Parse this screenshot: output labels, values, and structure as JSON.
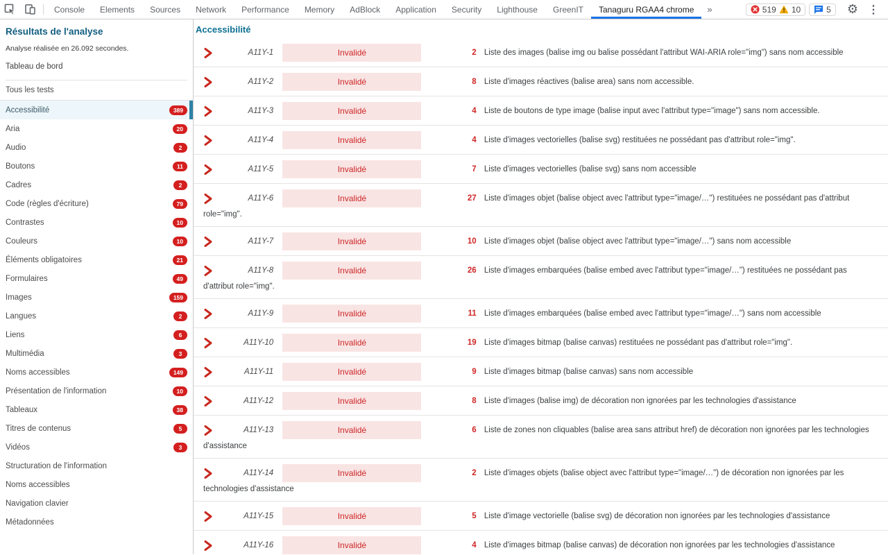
{
  "colors": {
    "accent_teal": "#0e7193",
    "sidebar_title_blue": "#135e80",
    "status_red": "#cd2626",
    "status_bg_pink": "#f9e4e4",
    "badge_red": "#d41f1f",
    "selected_bg": "#edf6fa",
    "selected_bar": "#2e81a5",
    "tab_active_blue": "#1a73e8"
  },
  "devtools": {
    "tabs": [
      {
        "label": "Console"
      },
      {
        "label": "Elements"
      },
      {
        "label": "Sources"
      },
      {
        "label": "Network"
      },
      {
        "label": "Performance"
      },
      {
        "label": "Memory"
      },
      {
        "label": "AdBlock"
      },
      {
        "label": "Application"
      },
      {
        "label": "Security"
      },
      {
        "label": "Lighthouse"
      },
      {
        "label": "GreenIT"
      },
      {
        "label": "Tanaguru RGAA4 chrome",
        "active": true
      }
    ],
    "more_tabs": "»",
    "error_count": "519",
    "warning_count": "10",
    "message_count": "5",
    "gear_glyph": "⚙",
    "dots_glyph": "⋮"
  },
  "sidebar": {
    "title": "Résultats de l'analyse",
    "subtitle": "Analyse réalisée en 26.092 secondes.",
    "dashboard_link": "Tableau de bord",
    "all_tests_label": "Tous les tests",
    "items": [
      {
        "label": "Accessibilité",
        "count": "389",
        "selected": true
      },
      {
        "label": "Aria",
        "count": "20"
      },
      {
        "label": "Audio",
        "count": "2"
      },
      {
        "label": "Boutons",
        "count": "11"
      },
      {
        "label": "Cadres",
        "count": "2"
      },
      {
        "label": "Code (règles d'écriture)",
        "count": "79"
      },
      {
        "label": "Contrastes",
        "count": "10"
      },
      {
        "label": "Couleurs",
        "count": "10"
      },
      {
        "label": "Éléments obligatoires",
        "count": "21"
      },
      {
        "label": "Formulaires",
        "count": "49"
      },
      {
        "label": "Images",
        "count": "159"
      },
      {
        "label": "Langues",
        "count": "2"
      },
      {
        "label": "Liens",
        "count": "6"
      },
      {
        "label": "Multimédia",
        "count": "3"
      },
      {
        "label": "Noms accessibles",
        "count": "149"
      },
      {
        "label": "Présentation de l'information",
        "count": "10"
      },
      {
        "label": "Tableaux",
        "count": "38"
      },
      {
        "label": "Titres de contenus",
        "count": "5"
      },
      {
        "label": "Vidéos",
        "count": "3"
      },
      {
        "label": "Structuration de l'information"
      },
      {
        "label": "Noms accessibles"
      },
      {
        "label": "Navigation clavier"
      },
      {
        "label": "Métadonnées"
      }
    ]
  },
  "main": {
    "title": "Accessibilité",
    "rows": [
      {
        "id": "A11Y-1",
        "status": "Invalidé",
        "count": "2",
        "description": "Liste des images (balise img ou balise possédant l'attribut WAI-ARIA role=\"img\") sans nom accessible"
      },
      {
        "id": "A11Y-2",
        "status": "Invalidé",
        "count": "8",
        "description": "Liste d'images réactives (balise area) sans nom accessible."
      },
      {
        "id": "A11Y-3",
        "status": "Invalidé",
        "count": "4",
        "description": "Liste de boutons de type image (balise input avec l'attribut type=\"image\") sans nom accessible."
      },
      {
        "id": "A11Y-4",
        "status": "Invalidé",
        "count": "4",
        "description": "Liste d'images vectorielles (balise svg) restituées ne possédant pas d'attribut role=\"img\"."
      },
      {
        "id": "A11Y-5",
        "status": "Invalidé",
        "count": "7",
        "description": "Liste d'images vectorielles (balise svg) sans nom accessible"
      },
      {
        "id": "A11Y-6",
        "status": "Invalidé",
        "count": "27",
        "description": "Liste d'images objet (balise object avec l'attribut type=\"image/…\") restituées ne possédant pas d'attribut role=\"img\"."
      },
      {
        "id": "A11Y-7",
        "status": "Invalidé",
        "count": "10",
        "description": "Liste d'images objet (balise object avec l'attribut type=\"image/…\") sans nom accessible"
      },
      {
        "id": "A11Y-8",
        "status": "Invalidé",
        "count": "26",
        "description": "Liste d'images embarquées (balise embed avec l'attribut type=\"image/…\") restituées ne possédant pas d'attribut role=\"img\"."
      },
      {
        "id": "A11Y-9",
        "status": "Invalidé",
        "count": "11",
        "description": "Liste d'images embarquées (balise embed avec l'attribut type=\"image/…\") sans nom accessible"
      },
      {
        "id": "A11Y-10",
        "status": "Invalidé",
        "count": "19",
        "description": "Liste d'images bitmap (balise canvas) restituées ne possédant pas d'attribut role=\"img\"."
      },
      {
        "id": "A11Y-11",
        "status": "Invalidé",
        "count": "9",
        "description": "Liste d'images bitmap (balise canvas) sans nom accessible"
      },
      {
        "id": "A11Y-12",
        "status": "Invalidé",
        "count": "8",
        "description": "Liste d'images (balise img) de décoration non ignorées par les technologies d'assistance"
      },
      {
        "id": "A11Y-13",
        "status": "Invalidé",
        "count": "6",
        "description": "Liste de zones non cliquables (balise area sans attribut href) de décoration non ignorées par les technologies d'assistance"
      },
      {
        "id": "A11Y-14",
        "status": "Invalidé",
        "count": "2",
        "description": "Liste d'images objets (balise object avec l'attribut type=\"image/…\") de décoration non ignorées par les technologies d'assistance"
      },
      {
        "id": "A11Y-15",
        "status": "Invalidé",
        "count": "5",
        "description": "Liste d'image vectorielle (balise svg) de décoration non ignorées par les technologies d'assistance"
      },
      {
        "id": "A11Y-16",
        "status": "Invalidé",
        "count": "4",
        "description": "Liste d'images bitmap (balise canvas) de décoration non ignorées par les technologies d'assistance"
      }
    ]
  }
}
